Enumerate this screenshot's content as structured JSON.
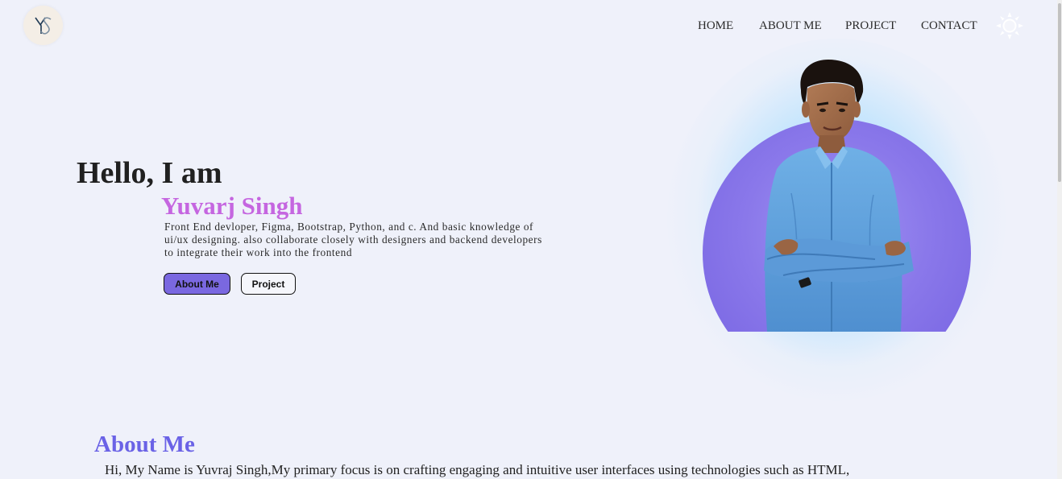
{
  "header": {
    "logo_text": "YS",
    "nav": [
      {
        "label": "HOME"
      },
      {
        "label": "ABOUT ME"
      },
      {
        "label": "PROJECT"
      },
      {
        "label": "CONTACT"
      }
    ],
    "theme_toggle_icon": "sun-icon"
  },
  "hero": {
    "greeting": "Hello, I am",
    "name": "Yuvarj Singh",
    "description": "Front End devloper, Figma, Bootstrap, Python, and c. And basic knowledge of ui/ux designing. also collaborate closely with designers and backend developers to integrate their work into the frontend",
    "buttons": {
      "about": "About Me",
      "project": "Project"
    },
    "photo_icon": "profile-photo"
  },
  "about": {
    "title": "About Me",
    "text": "Hi, My Name is Yuvraj Singh,My primary focus is on crafting engaging and intuitive user interfaces using technologies such as HTML,"
  },
  "colors": {
    "background": "#eff1fa",
    "accent_name": "#c566e0",
    "accent_title": "#6a62e6",
    "primary_button": "#7a68e0"
  }
}
